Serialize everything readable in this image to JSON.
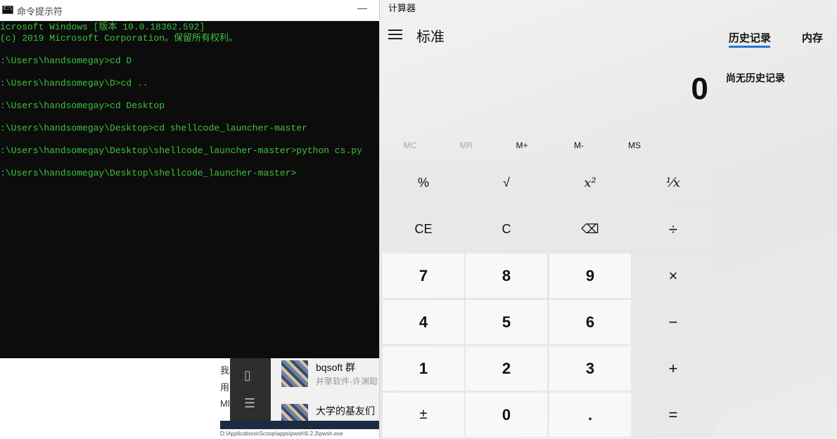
{
  "cmd": {
    "title": "命令提示符",
    "minimize": "—",
    "lines": [
      "icrosoft Windows [版本 10.0.18362.592]",
      "(c) 2019 Microsoft Corporation。保留所有权利。",
      "",
      ":\\Users\\handsomegay>cd D",
      "",
      ":\\Users\\handsomegay\\D>cd ..",
      "",
      ":\\Users\\handsomegay>cd Desktop",
      "",
      ":\\Users\\handsomegay\\Desktop>cd shellcode_launcher-master",
      "",
      ":\\Users\\handsomegay\\Desktop\\shellcode_launcher-master>python cs.py",
      "",
      ":\\Users\\handsomegay\\Desktop\\shellcode_launcher-master>"
    ],
    "colors": {
      "background": "#0c0c0c",
      "text": "#3ec23e"
    }
  },
  "background_app": {
    "left_text": [
      "我",
      "用",
      "Ml"
    ],
    "sidebar_icons": [
      "phone-icon",
      "menu-icon"
    ],
    "chats": [
      {
        "name": "bqsoft 群",
        "preview": "并擎软件-许渊聪"
      },
      {
        "name": "大学的基友们",
        "preview": ""
      }
    ],
    "taskbar_path": "D:\\Applications\\Scoop\\apps\\pwsh\\6.2.3\\pwsh.exe"
  },
  "calculator": {
    "app_title": "计算器",
    "mode": "标准",
    "display": "0",
    "memory": [
      "MC",
      "MR",
      "M+",
      "M-",
      "MS"
    ],
    "memory_disabled": [
      true,
      true,
      false,
      false,
      false
    ],
    "tabs": [
      "历史记录",
      "内存"
    ],
    "history_empty": "尚无历史记录",
    "keys": [
      [
        "%",
        "√",
        "x²",
        "¹⁄x"
      ],
      [
        "CE",
        "C",
        "⌫",
        "÷"
      ],
      [
        "7",
        "8",
        "9",
        "×"
      ],
      [
        "4",
        "5",
        "6",
        "−"
      ],
      [
        "1",
        "2",
        "3",
        "+"
      ],
      [
        "±",
        "0",
        ".",
        "="
      ]
    ],
    "accent": "#1f78d1"
  }
}
